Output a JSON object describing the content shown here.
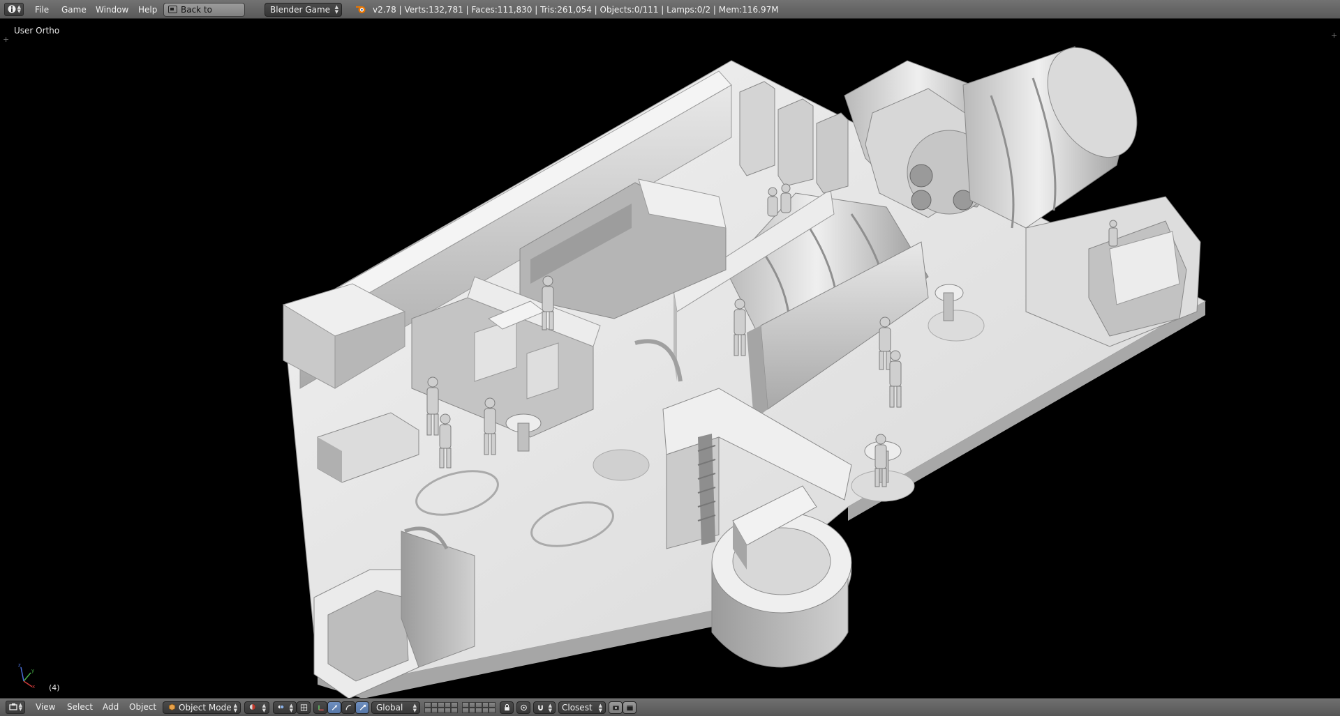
{
  "topbar": {
    "menus": [
      "File",
      "Game",
      "Window",
      "Help"
    ],
    "back_button": "Back to Previous",
    "engine": "Blender Game",
    "stats": "v2.78 | Verts:132,781 | Faces:111,830 | Tris:261,054 | Objects:0/111 | Lamps:0/2 | Mem:116.97M"
  },
  "viewport": {
    "view_name": "User Ortho",
    "frame": "(4)",
    "axis_labels": {
      "x": "x",
      "y": "y",
      "z": "z"
    }
  },
  "bottombar": {
    "menus": [
      "View",
      "Select",
      "Add",
      "Object"
    ],
    "mode": "Object Mode",
    "orientation": "Global",
    "snap_target": "Closest"
  },
  "colors": {
    "header_bg": "#636363",
    "viewport_bg": "#000000",
    "model_light": "#e6e6e6",
    "model_mid": "#bcbcbc",
    "model_dark": "#8f8f8f",
    "active_button": "#5f7fb0"
  }
}
